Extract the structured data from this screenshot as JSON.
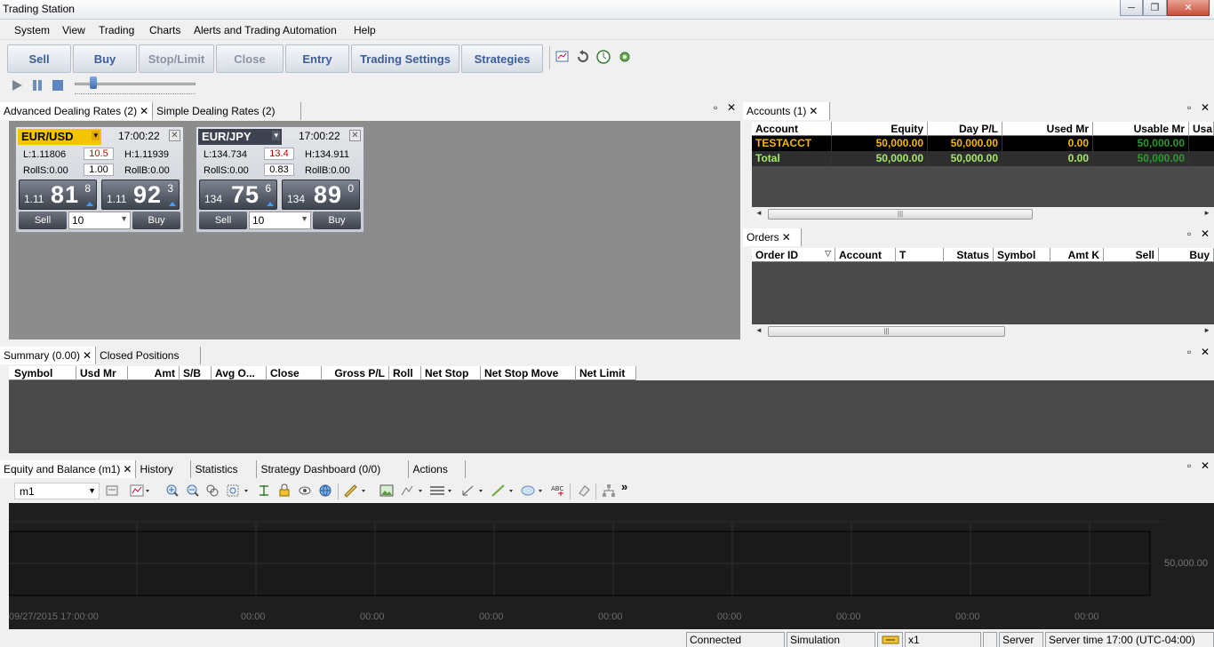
{
  "window": {
    "title": "Trading Station"
  },
  "menu": [
    "System",
    "View",
    "Trading",
    "Charts",
    "Alerts and Trading Automation",
    "Help"
  ],
  "toolbar": {
    "sell": "Sell",
    "buy": "Buy",
    "stop_limit": "Stop/Limit",
    "close": "Close",
    "entry": "Entry",
    "trading_settings": "Trading Settings",
    "strategies": "Strategies"
  },
  "rates_panel": {
    "tabs": [
      "Advanced Dealing Rates (2)",
      "Simple Dealing Rates (2)"
    ],
    "tickets": [
      {
        "symbol": "EUR/USD",
        "time": "17:00:22",
        "low": "L:1.11806",
        "spread": "10.5",
        "high": "H:1.11939",
        "roll_s": "RollS:0.00",
        "roll_val": "1.00",
        "roll_b": "RollB:0.00",
        "sell_prefix": "1.11",
        "sell_big": "81",
        "sell_pip": "8",
        "buy_prefix": "1.11",
        "buy_big": "92",
        "buy_pip": "3",
        "sell_label": "Sell",
        "amount": "10",
        "buy_label": "Buy",
        "highlight_color": "#f5c400"
      },
      {
        "symbol": "EUR/JPY",
        "time": "17:00:22",
        "low": "L:134.734",
        "spread": "13.4",
        "high": "H:134.911",
        "roll_s": "RollS:0.00",
        "roll_val": "0.83",
        "roll_b": "RollB:0.00",
        "sell_prefix": "134",
        "sell_big": "75",
        "sell_pip": "6",
        "buy_prefix": "134",
        "buy_big": "89",
        "buy_pip": "0",
        "sell_label": "Sell",
        "amount": "10",
        "buy_label": "Buy",
        "highlight_color": "#3d4350"
      }
    ]
  },
  "accounts": {
    "tab": "Accounts (1)",
    "columns": [
      "Account",
      "Equity",
      "Day P/L",
      "Used Mr",
      "Usable Mr",
      "Usa"
    ],
    "rows": [
      {
        "account": "TESTACCT",
        "equity": "50,000.00",
        "day_pl": "50,000.00",
        "used_mr": "0.00",
        "usable_mr": "50,000.00"
      },
      {
        "account": "Total",
        "equity": "50,000.00",
        "day_pl": "50,000.00",
        "used_mr": "0.00",
        "usable_mr": "50,000.00"
      }
    ]
  },
  "orders": {
    "tab": "Orders",
    "columns": [
      "Order ID",
      "Account",
      "T",
      "Status",
      "Symbol",
      "Amt K",
      "Sell",
      "Buy"
    ]
  },
  "summary": {
    "tabs": [
      "Summary (0.00)",
      "Closed Positions"
    ],
    "columns": [
      "Symbol",
      "Usd Mr",
      "Amt",
      "S/B",
      "Avg O...",
      "Close",
      "Gross P/L",
      "Roll",
      "Net Stop",
      "Net Stop Move",
      "Net Limit"
    ]
  },
  "chart_panel": {
    "tabs": [
      "Equity and Balance (m1)",
      "History",
      "Statistics",
      "Strategy Dashboard (0/0)",
      "Actions"
    ],
    "timeframe": "m1",
    "more": "»",
    "y_label": "50,000.00",
    "x_labels": [
      "09/27/2015 17:00:00",
      "00:00",
      "00:00",
      "00:00",
      "00:00",
      "00:00",
      "00:00",
      "00:00",
      "00:00",
      "00:00"
    ]
  },
  "status": {
    "connected": "Connected",
    "mode": "Simulation",
    "speed": "x1",
    "server": "Server",
    "server_time": "Server time 17:00 (UTC-04:00)"
  }
}
